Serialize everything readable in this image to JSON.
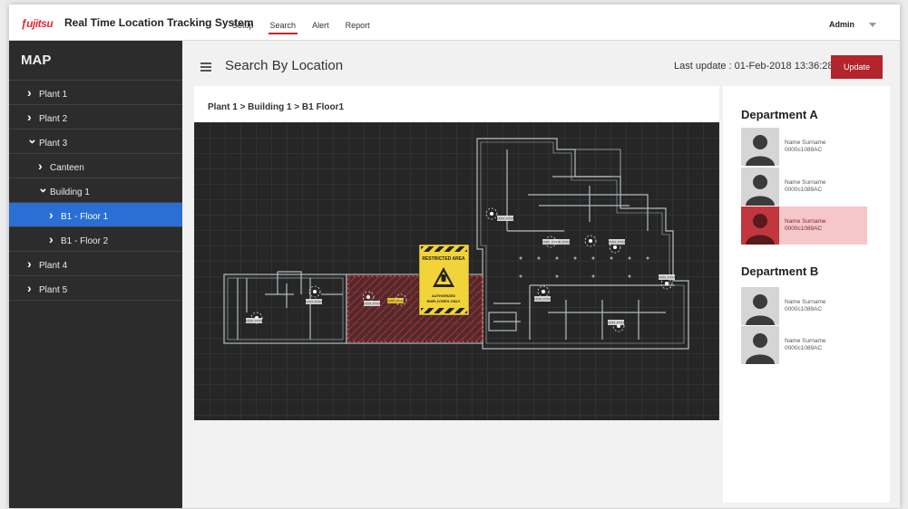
{
  "app": {
    "logo": "FUJITSU",
    "title": "Real Time Location Tracking System",
    "nav": [
      "Setup",
      "Search",
      "Alert",
      "Report"
    ],
    "nav_active": "Search",
    "user": "Admin"
  },
  "sidebar": {
    "title": "MAP",
    "items": [
      {
        "label": "Plant 1",
        "level": 0,
        "chevron": "right"
      },
      {
        "label": "Plant 2",
        "level": 0,
        "chevron": "right"
      },
      {
        "label": "Plant 3",
        "level": 0,
        "chevron": "down"
      },
      {
        "label": "Canteen",
        "level": 1,
        "chevron": "right"
      },
      {
        "label": "Building 1",
        "level": 1,
        "chevron": "down"
      },
      {
        "label": "B1 - Floor 1",
        "level": 2,
        "chevron": "right",
        "active": true
      },
      {
        "label": "B1 - Floor 2",
        "level": 2,
        "chevron": "right"
      },
      {
        "label": "Plant 4",
        "level": 0,
        "chevron": "right"
      },
      {
        "label": "Plant 5",
        "level": 0,
        "chevron": "right"
      }
    ]
  },
  "header": {
    "title": "Search By Location",
    "last_update": "Last update : 01-Feb-2018 13:36:28",
    "update_button": "Update"
  },
  "map": {
    "breadcrumb": "Plant 1 > Building 1 > B1 Floor1",
    "restricted_title": "RESTRICTED AREA",
    "restricted_note_1": "AUTHORIZED",
    "restricted_note_2": "EMPLOYEES ONLY",
    "tag_label": "XXXX.XYXX",
    "colors": {
      "background": "#262626",
      "walls": "#c9d6dc",
      "restricted": "#c7343a",
      "warning": "#f2d43a"
    }
  },
  "departments": [
    {
      "name": "Department A",
      "people": [
        {
          "name": "Name Surname",
          "id": "0000c1089AC",
          "highlight": false
        },
        {
          "name": "Name Surname",
          "id": "0000c1089AC",
          "highlight": false
        },
        {
          "name": "Name Surname",
          "id": "0000c1089AC",
          "highlight": true
        }
      ]
    },
    {
      "name": "Department B",
      "people": [
        {
          "name": "Name Surname",
          "id": "0000c1089AC",
          "highlight": false
        },
        {
          "name": "Name Surname",
          "id": "0000c1089AC",
          "highlight": false
        }
      ]
    }
  ]
}
